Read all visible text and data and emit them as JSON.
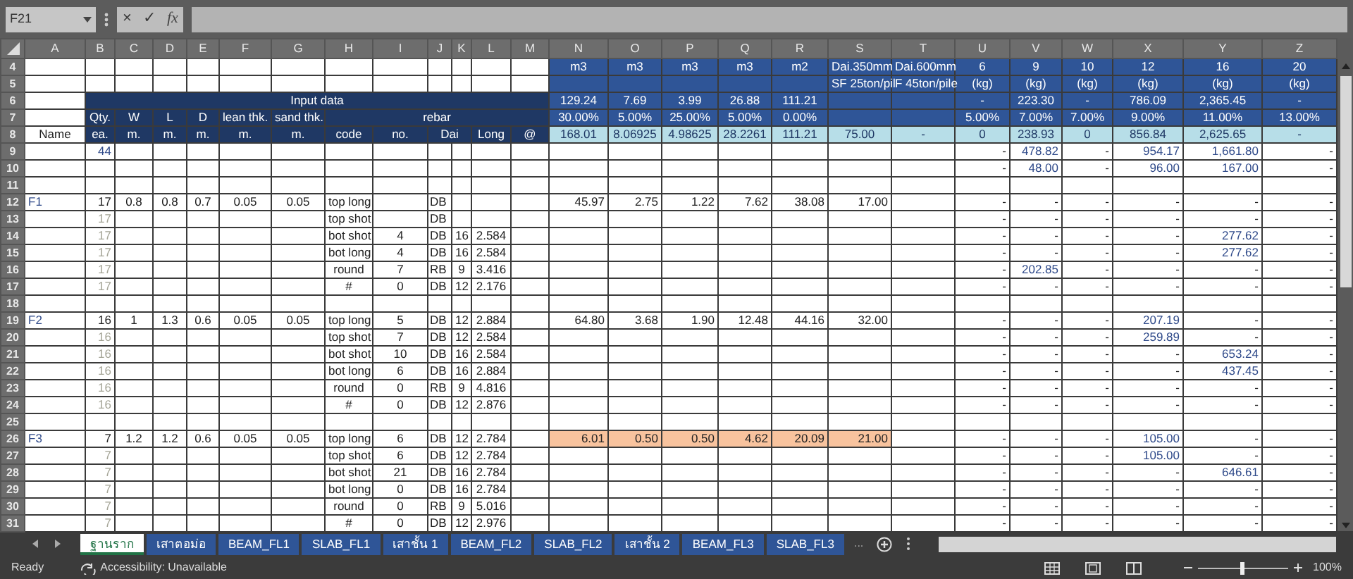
{
  "name_box": "F21",
  "formula_buttons": [
    "×",
    "✓",
    "fx"
  ],
  "columns": [
    "A",
    "B",
    "C",
    "D",
    "E",
    "F",
    "G",
    "H",
    "I",
    "J",
    "K",
    "L",
    "M",
    "N",
    "O",
    "P",
    "Q",
    "R",
    "S",
    "T",
    "U",
    "V",
    "W",
    "X",
    "Y",
    "Z"
  ],
  "rows": [
    {
      "row": "4",
      "kind": "units",
      "cells": [
        {},
        {},
        {},
        {},
        {},
        {},
        {},
        {},
        {},
        {},
        {},
        {},
        {},
        {
          "text": "m3"
        },
        {
          "text": "m3"
        },
        {
          "text": "m3"
        },
        {
          "text": "m3"
        },
        {
          "text": "m2"
        },
        {
          "text": "Dai.350mm"
        },
        {
          "text": "Dai.600mm"
        },
        {
          "text": "6"
        },
        {
          "text": "9"
        },
        {
          "text": "10"
        },
        {
          "text": "12"
        },
        {
          "text": "16"
        },
        {
          "text": "20"
        }
      ]
    },
    {
      "row": "5",
      "kind": "units",
      "cells": [
        {},
        {},
        {},
        {},
        {},
        {},
        {},
        {},
        {},
        {},
        {},
        {},
        {},
        {},
        {},
        {},
        {},
        {},
        {
          "text": "SF 25ton/pil"
        },
        {
          "text": "F 45ton/pile"
        },
        {
          "text": "(kg)"
        },
        {
          "text": "(kg)"
        },
        {
          "text": "(kg)"
        },
        {
          "text": "(kg)"
        },
        {
          "text": "(kg)"
        },
        {
          "text": "(kg)"
        }
      ]
    },
    {
      "row": "6",
      "kind": "input",
      "cells": [
        {},
        {
          "text": "Input data",
          "merged": true
        },
        {},
        {},
        {},
        {},
        {},
        {},
        {},
        {},
        {},
        {},
        {},
        {
          "text": "129.24"
        },
        {
          "text": "7.69"
        },
        {
          "text": "3.99"
        },
        {
          "text": "26.88"
        },
        {
          "text": "111.21"
        },
        {},
        {},
        {
          "text": "-"
        },
        {
          "text": "223.30"
        },
        {
          "text": "-"
        },
        {
          "text": "786.09"
        },
        {
          "text": "2,365.45"
        },
        {
          "text": "-"
        }
      ]
    },
    {
      "row": "7",
      "kind": "input",
      "cells": [
        {},
        {
          "text": "Qty."
        },
        {
          "text": "W"
        },
        {
          "text": "L"
        },
        {
          "text": "D"
        },
        {
          "text": "lean thk."
        },
        {
          "text": "sand thk."
        },
        {
          "text": "rebar",
          "merged": true
        },
        {},
        {},
        {},
        {},
        {},
        {
          "text": "30.00%"
        },
        {
          "text": "5.00%"
        },
        {
          "text": "25.00%"
        },
        {
          "text": "5.00%"
        },
        {
          "text": "0.00%"
        },
        {},
        {},
        {
          "text": "5.00%"
        },
        {
          "text": "7.00%"
        },
        {
          "text": "7.00%"
        },
        {
          "text": "9.00%"
        },
        {
          "text": "11.00%"
        },
        {
          "text": "13.00%"
        }
      ]
    },
    {
      "row": "8",
      "kind": "totals",
      "cells": [
        {
          "text": "Name"
        },
        {
          "text": "ea."
        },
        {
          "text": "m."
        },
        {
          "text": "m."
        },
        {
          "text": "m."
        },
        {
          "text": "m."
        },
        {
          "text": "m."
        },
        {
          "text": "code"
        },
        {
          "text": "no."
        },
        {
          "text": "Dai",
          "merged": true
        },
        {},
        {
          "text": "Long"
        },
        {
          "text": "@"
        },
        {
          "text": "168.01"
        },
        {
          "text": "8.06925"
        },
        {
          "text": "4.98625"
        },
        {
          "text": "28.2261"
        },
        {
          "text": "111.21"
        },
        {
          "text": "75.00"
        },
        {
          "text": "-"
        },
        {
          "text": "0"
        },
        {
          "text": "238.93"
        },
        {
          "text": "0"
        },
        {
          "text": "856.84"
        },
        {
          "text": "2,625.65"
        },
        {
          "text": "-"
        }
      ]
    },
    {
      "row": "9",
      "kind": "data",
      "cells": [
        {},
        {
          "text": "44",
          "color": "#2f4a8a"
        },
        {},
        {},
        {},
        {},
        {},
        {},
        {},
        {},
        {},
        {},
        {},
        {},
        {},
        {},
        {},
        {},
        {},
        {},
        {
          "text": "-"
        },
        {
          "text": "478.82",
          "color": "#2f4a8a"
        },
        {
          "text": "-"
        },
        {
          "text": "954.17",
          "color": "#2f4a8a"
        },
        {
          "text": "1,661.80",
          "color": "#2f4a8a"
        },
        {
          "text": "-"
        }
      ]
    },
    {
      "row": "10",
      "kind": "data",
      "cells": [
        {},
        {},
        {},
        {},
        {},
        {},
        {},
        {},
        {},
        {},
        {},
        {},
        {},
        {},
        {},
        {},
        {},
        {},
        {},
        {},
        {
          "text": "-"
        },
        {
          "text": "48.00",
          "color": "#2f4a8a"
        },
        {
          "text": "-"
        },
        {
          "text": "96.00",
          "color": "#2f4a8a"
        },
        {
          "text": "167.00",
          "color": "#2f4a8a"
        },
        {
          "text": "-"
        }
      ]
    },
    {
      "row": "11",
      "kind": "data"
    },
    {
      "row": "12",
      "kind": "data",
      "cells": [
        {
          "text": "F1",
          "color": "#2f4a8a"
        },
        {
          "text": "17"
        },
        {
          "text": "0.8"
        },
        {
          "text": "0.8"
        },
        {
          "text": "0.7"
        },
        {
          "text": "0.05"
        },
        {
          "text": "0.05"
        },
        {
          "text": "top long"
        },
        {},
        {
          "text": "DB"
        },
        {},
        {},
        {},
        {
          "text": "45.97"
        },
        {
          "text": "2.75"
        },
        {
          "text": "1.22"
        },
        {
          "text": "7.62"
        },
        {
          "text": "38.08"
        },
        {
          "text": "17.00"
        },
        {},
        {
          "text": "-"
        },
        {
          "text": "-"
        },
        {
          "text": "-"
        },
        {
          "text": "-"
        },
        {
          "text": "-"
        },
        {
          "text": "-"
        }
      ]
    },
    {
      "row": "13",
      "kind": "data",
      "cells": [
        {},
        {
          "text": "17",
          "color": "#a4a496"
        },
        {},
        {},
        {},
        {},
        {},
        {
          "text": "top shot"
        },
        {},
        {
          "text": "DB"
        },
        {},
        {},
        {},
        {},
        {},
        {},
        {},
        {},
        {},
        {},
        {
          "text": "-"
        },
        {
          "text": "-"
        },
        {
          "text": "-"
        },
        {
          "text": "-"
        },
        {
          "text": "-"
        },
        {
          "text": "-"
        }
      ]
    },
    {
      "row": "14",
      "kind": "data",
      "cells": [
        {},
        {
          "text": "17",
          "color": "#a4a496"
        },
        {},
        {},
        {},
        {},
        {},
        {
          "text": "bot shot"
        },
        {
          "text": "4"
        },
        {
          "text": "DB"
        },
        {
          "text": "16"
        },
        {
          "text": "2.584"
        },
        {},
        {},
        {},
        {},
        {},
        {},
        {},
        {},
        {
          "text": "-"
        },
        {
          "text": "-"
        },
        {
          "text": "-"
        },
        {
          "text": "-"
        },
        {
          "text": "277.62",
          "color": "#2f4a8a"
        },
        {
          "text": "-"
        }
      ]
    },
    {
      "row": "15",
      "kind": "data",
      "cells": [
        {},
        {
          "text": "17",
          "color": "#a4a496"
        },
        {},
        {},
        {},
        {},
        {},
        {
          "text": "bot long"
        },
        {
          "text": "4"
        },
        {
          "text": "DB"
        },
        {
          "text": "16"
        },
        {
          "text": "2.584"
        },
        {},
        {},
        {},
        {},
        {},
        {},
        {},
        {},
        {
          "text": "-"
        },
        {
          "text": "-"
        },
        {
          "text": "-"
        },
        {
          "text": "-"
        },
        {
          "text": "277.62",
          "color": "#2f4a8a"
        },
        {
          "text": "-"
        }
      ]
    },
    {
      "row": "16",
      "kind": "data",
      "cells": [
        {},
        {
          "text": "17",
          "color": "#a4a496"
        },
        {},
        {},
        {},
        {},
        {},
        {
          "text": "round"
        },
        {
          "text": "7"
        },
        {
          "text": "RB"
        },
        {
          "text": "9"
        },
        {
          "text": "3.416"
        },
        {},
        {},
        {},
        {},
        {},
        {},
        {},
        {},
        {
          "text": "-"
        },
        {
          "text": "202.85",
          "color": "#2f4a8a"
        },
        {
          "text": "-"
        },
        {
          "text": "-"
        },
        {
          "text": "-"
        },
        {
          "text": "-"
        }
      ]
    },
    {
      "row": "17",
      "kind": "data",
      "cells": [
        {},
        {
          "text": "17",
          "color": "#a4a496"
        },
        {},
        {},
        {},
        {},
        {},
        {
          "text": "#"
        },
        {
          "text": "0"
        },
        {
          "text": "DB"
        },
        {
          "text": "12"
        },
        {
          "text": "2.176"
        },
        {},
        {},
        {},
        {},
        {},
        {},
        {},
        {},
        {
          "text": "-"
        },
        {
          "text": "-"
        },
        {
          "text": "-"
        },
        {
          "text": "-"
        },
        {
          "text": "-"
        },
        {
          "text": "-"
        }
      ]
    },
    {
      "row": "18",
      "kind": "data"
    },
    {
      "row": "19",
      "kind": "data",
      "cells": [
        {
          "text": "F2",
          "color": "#2f4a8a"
        },
        {
          "text": "16"
        },
        {
          "text": "1"
        },
        {
          "text": "1.3"
        },
        {
          "text": "0.6"
        },
        {
          "text": "0.05"
        },
        {
          "text": "0.05"
        },
        {
          "text": "top long"
        },
        {
          "text": "5"
        },
        {
          "text": "DB"
        },
        {
          "text": "12"
        },
        {
          "text": "2.884"
        },
        {},
        {
          "text": "64.80"
        },
        {
          "text": "3.68"
        },
        {
          "text": "1.90"
        },
        {
          "text": "12.48"
        },
        {
          "text": "44.16"
        },
        {
          "text": "32.00"
        },
        {},
        {
          "text": "-"
        },
        {
          "text": "-"
        },
        {
          "text": "-"
        },
        {
          "text": "207.19",
          "color": "#2f4a8a"
        },
        {
          "text": "-"
        },
        {
          "text": "-"
        }
      ]
    },
    {
      "row": "20",
      "kind": "data",
      "cells": [
        {},
        {
          "text": "16",
          "color": "#a4a496"
        },
        {},
        {},
        {},
        {},
        {},
        {
          "text": "top shot"
        },
        {
          "text": "7"
        },
        {
          "text": "DB"
        },
        {
          "text": "12"
        },
        {
          "text": "2.584"
        },
        {},
        {},
        {},
        {},
        {},
        {},
        {},
        {},
        {
          "text": "-"
        },
        {
          "text": "-"
        },
        {
          "text": "-"
        },
        {
          "text": "259.89",
          "color": "#2f4a8a"
        },
        {
          "text": "-"
        },
        {
          "text": "-"
        }
      ]
    },
    {
      "row": "21",
      "kind": "data",
      "cells": [
        {},
        {
          "text": "16",
          "color": "#a4a496"
        },
        {},
        {},
        {},
        {},
        {},
        {
          "text": "bot shot"
        },
        {
          "text": "10"
        },
        {
          "text": "DB"
        },
        {
          "text": "16"
        },
        {
          "text": "2.584"
        },
        {},
        {},
        {},
        {},
        {},
        {},
        {},
        {},
        {
          "text": "-"
        },
        {
          "text": "-"
        },
        {
          "text": "-"
        },
        {
          "text": "-"
        },
        {
          "text": "653.24",
          "color": "#2f4a8a"
        },
        {
          "text": "-"
        }
      ]
    },
    {
      "row": "22",
      "kind": "data",
      "cells": [
        {},
        {
          "text": "16",
          "color": "#a4a496"
        },
        {},
        {},
        {},
        {},
        {},
        {
          "text": "bot long"
        },
        {
          "text": "6"
        },
        {
          "text": "DB"
        },
        {
          "text": "16"
        },
        {
          "text": "2.884"
        },
        {},
        {},
        {},
        {},
        {},
        {},
        {},
        {},
        {
          "text": "-"
        },
        {
          "text": "-"
        },
        {
          "text": "-"
        },
        {
          "text": "-"
        },
        {
          "text": "437.45",
          "color": "#2f4a8a"
        },
        {
          "text": "-"
        }
      ]
    },
    {
      "row": "23",
      "kind": "data",
      "cells": [
        {},
        {
          "text": "16",
          "color": "#a4a496"
        },
        {},
        {},
        {},
        {},
        {},
        {
          "text": "round"
        },
        {
          "text": "0"
        },
        {
          "text": "RB"
        },
        {
          "text": "9"
        },
        {
          "text": "4.816"
        },
        {},
        {},
        {},
        {},
        {},
        {},
        {},
        {},
        {
          "text": "-"
        },
        {
          "text": "-"
        },
        {
          "text": "-"
        },
        {
          "text": "-"
        },
        {
          "text": "-"
        },
        {
          "text": "-"
        }
      ]
    },
    {
      "row": "24",
      "kind": "data",
      "cells": [
        {},
        {
          "text": "16",
          "color": "#a4a496"
        },
        {},
        {},
        {},
        {},
        {},
        {
          "text": "#"
        },
        {
          "text": "0"
        },
        {
          "text": "DB"
        },
        {
          "text": "12"
        },
        {
          "text": "2.876"
        },
        {},
        {},
        {},
        {},
        {},
        {},
        {},
        {},
        {
          "text": "-"
        },
        {
          "text": "-"
        },
        {
          "text": "-"
        },
        {
          "text": "-"
        },
        {
          "text": "-"
        },
        {
          "text": "-"
        }
      ]
    },
    {
      "row": "25",
      "kind": "data"
    },
    {
      "row": "26",
      "kind": "data",
      "highlight": true,
      "cells": [
        {
          "text": "F3",
          "color": "#2f4a8a"
        },
        {
          "text": "7"
        },
        {
          "text": "1.2"
        },
        {
          "text": "1.2"
        },
        {
          "text": "0.6"
        },
        {
          "text": "0.05"
        },
        {
          "text": "0.05"
        },
        {
          "text": "top long"
        },
        {
          "text": "6"
        },
        {
          "text": "DB"
        },
        {
          "text": "12"
        },
        {
          "text": "2.784"
        },
        {},
        {
          "text": "6.01"
        },
        {
          "text": "0.50"
        },
        {
          "text": "0.50"
        },
        {
          "text": "4.62"
        },
        {
          "text": "20.09"
        },
        {
          "text": "21.00"
        },
        {},
        {
          "text": "-"
        },
        {
          "text": "-"
        },
        {
          "text": "-"
        },
        {
          "text": "105.00",
          "color": "#2f4a8a"
        },
        {
          "text": "-"
        },
        {
          "text": "-"
        }
      ]
    },
    {
      "row": "27",
      "kind": "data",
      "cells": [
        {},
        {
          "text": "7",
          "color": "#a4a496"
        },
        {},
        {},
        {},
        {},
        {},
        {
          "text": "top shot"
        },
        {
          "text": "6"
        },
        {
          "text": "DB"
        },
        {
          "text": "12"
        },
        {
          "text": "2.784"
        },
        {},
        {},
        {},
        {},
        {},
        {},
        {},
        {},
        {
          "text": "-"
        },
        {
          "text": "-"
        },
        {
          "text": "-"
        },
        {
          "text": "105.00",
          "color": "#2f4a8a"
        },
        {
          "text": "-"
        },
        {
          "text": "-"
        }
      ]
    },
    {
      "row": "28",
      "kind": "data",
      "cells": [
        {},
        {
          "text": "7",
          "color": "#a4a496"
        },
        {},
        {},
        {},
        {},
        {},
        {
          "text": "bot shot"
        },
        {
          "text": "21"
        },
        {
          "text": "DB"
        },
        {
          "text": "16"
        },
        {
          "text": "2.784"
        },
        {},
        {},
        {},
        {},
        {},
        {},
        {},
        {},
        {
          "text": "-"
        },
        {
          "text": "-"
        },
        {
          "text": "-"
        },
        {
          "text": "-"
        },
        {
          "text": "646.61",
          "color": "#2f4a8a"
        },
        {
          "text": "-"
        }
      ]
    },
    {
      "row": "29",
      "kind": "data",
      "cells": [
        {},
        {
          "text": "7",
          "color": "#a4a496"
        },
        {},
        {},
        {},
        {},
        {},
        {
          "text": "bot long"
        },
        {
          "text": "0"
        },
        {
          "text": "DB"
        },
        {
          "text": "16"
        },
        {
          "text": "2.784"
        },
        {},
        {},
        {},
        {},
        {},
        {},
        {},
        {},
        {
          "text": "-"
        },
        {
          "text": "-"
        },
        {
          "text": "-"
        },
        {
          "text": "-"
        },
        {
          "text": "-"
        },
        {
          "text": "-"
        }
      ]
    },
    {
      "row": "30",
      "kind": "data",
      "cells": [
        {},
        {
          "text": "7",
          "color": "#a4a496"
        },
        {},
        {},
        {},
        {},
        {},
        {
          "text": "round"
        },
        {
          "text": "0"
        },
        {
          "text": "RB"
        },
        {
          "text": "9"
        },
        {
          "text": "5.016"
        },
        {},
        {},
        {},
        {},
        {},
        {},
        {},
        {},
        {
          "text": "-"
        },
        {
          "text": "-"
        },
        {
          "text": "-"
        },
        {
          "text": "-"
        },
        {
          "text": "-"
        },
        {
          "text": "-"
        }
      ]
    },
    {
      "row": "31",
      "kind": "data",
      "cells": [
        {},
        {
          "text": "7",
          "color": "#a4a496"
        },
        {},
        {},
        {},
        {},
        {},
        {
          "text": "#"
        },
        {
          "text": "0"
        },
        {
          "text": "DB"
        },
        {
          "text": "12"
        },
        {
          "text": "2.976"
        },
        {},
        {},
        {},
        {},
        {},
        {},
        {},
        {},
        {
          "text": "-"
        },
        {
          "text": "-"
        },
        {
          "text": "-"
        },
        {
          "text": "-"
        },
        {
          "text": "-"
        },
        {
          "text": "-"
        }
      ]
    }
  ],
  "sheet_tabs": [
    {
      "label": "ฐานราก",
      "selected": true
    },
    {
      "label": "เสาตอม่อ",
      "selected": false
    },
    {
      "label": "BEAM_FL1",
      "selected": false
    },
    {
      "label": "SLAB_FL1",
      "selected": false
    },
    {
      "label": "เสาชั้น 1",
      "selected": false
    },
    {
      "label": "BEAM_FL2",
      "selected": false
    },
    {
      "label": "SLAB_FL2",
      "selected": false
    },
    {
      "label": "เสาชั้น 2",
      "selected": false
    },
    {
      "label": "BEAM_FL3",
      "selected": false
    },
    {
      "label": "SLAB_FL3",
      "selected": false
    }
  ],
  "more_tabs": "...",
  "status_bar": {
    "mode": "Ready",
    "accessibility": "Accessibility: Unavailable",
    "zoom": {
      "label": "100%",
      "level": 0.5
    }
  }
}
